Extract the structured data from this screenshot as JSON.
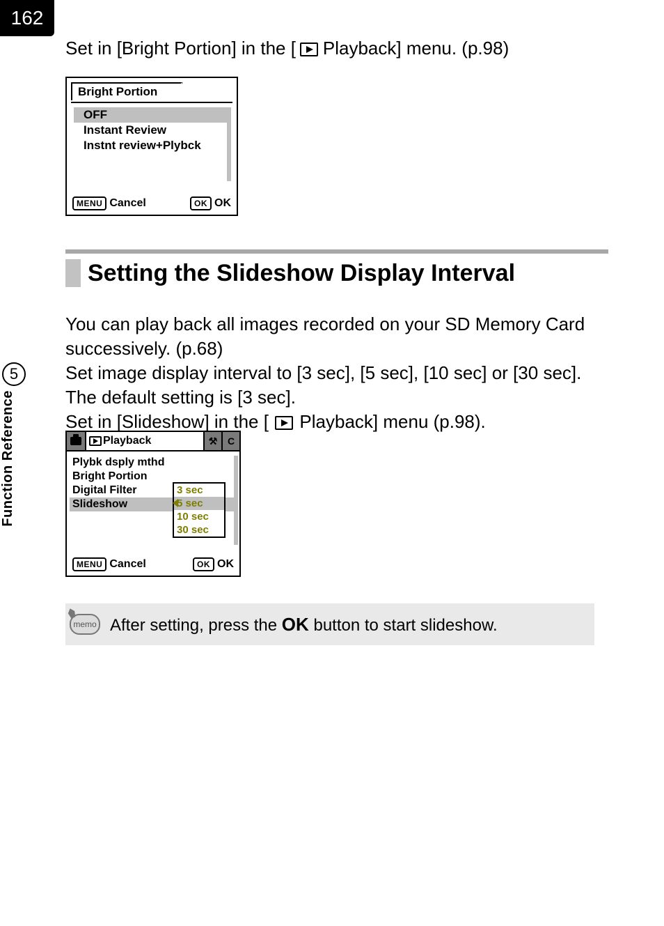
{
  "page_number": "162",
  "side_tab": {
    "chapter_number": "5",
    "label": "Function Reference"
  },
  "intro_sentence_prefix": "Set in [Bright Portion] in the [",
  "intro_sentence_suffix": " Playback] menu. (p.98)",
  "lcd1": {
    "tab_title": "Bright Portion",
    "options": [
      "OFF",
      "Instant Review",
      "Instnt review+Plybck"
    ],
    "selected_index": 0,
    "footer_menu_btn": "MENU",
    "footer_cancel": "Cancel",
    "footer_ok_btn": "OK",
    "footer_ok": "OK"
  },
  "section_heading": "Setting the Slideshow Display Interval",
  "body_p1": "You can play back all images recorded on your SD Memory Card successively. (p.68)",
  "body_p2": "Set image display interval to [3 sec], [5 sec], [10 sec] or [30 sec]. The default setting is [3 sec].",
  "body_p3_prefix": "Set in [Slideshow] in the [",
  "body_p3_suffix": " Playback] menu (p.98).",
  "lcd2": {
    "tab_play_label": "Playback",
    "tab_tools_glyph": "⚒",
    "tab_custom_glyph": "C",
    "rows": [
      {
        "label": "Plybk dsply mthd",
        "val": ""
      },
      {
        "label": "Bright Portion",
        "val": ""
      },
      {
        "label": "Digital Filter",
        "val": "3 sec"
      },
      {
        "label": "Slideshow",
        "val": "5 sec"
      }
    ],
    "highlight_index": 3,
    "dropdown_options": [
      "3 sec",
      "5 sec",
      "10 sec",
      "30 sec"
    ],
    "dropdown_selected_index": 1,
    "footer_menu_btn": "MENU",
    "footer_cancel": "Cancel",
    "footer_ok_btn": "OK",
    "footer_ok": "OK"
  },
  "memo": {
    "icon_label": "memo",
    "text_prefix": "After setting, press the ",
    "ok_label": "OK",
    "text_suffix": " button to start slideshow."
  }
}
